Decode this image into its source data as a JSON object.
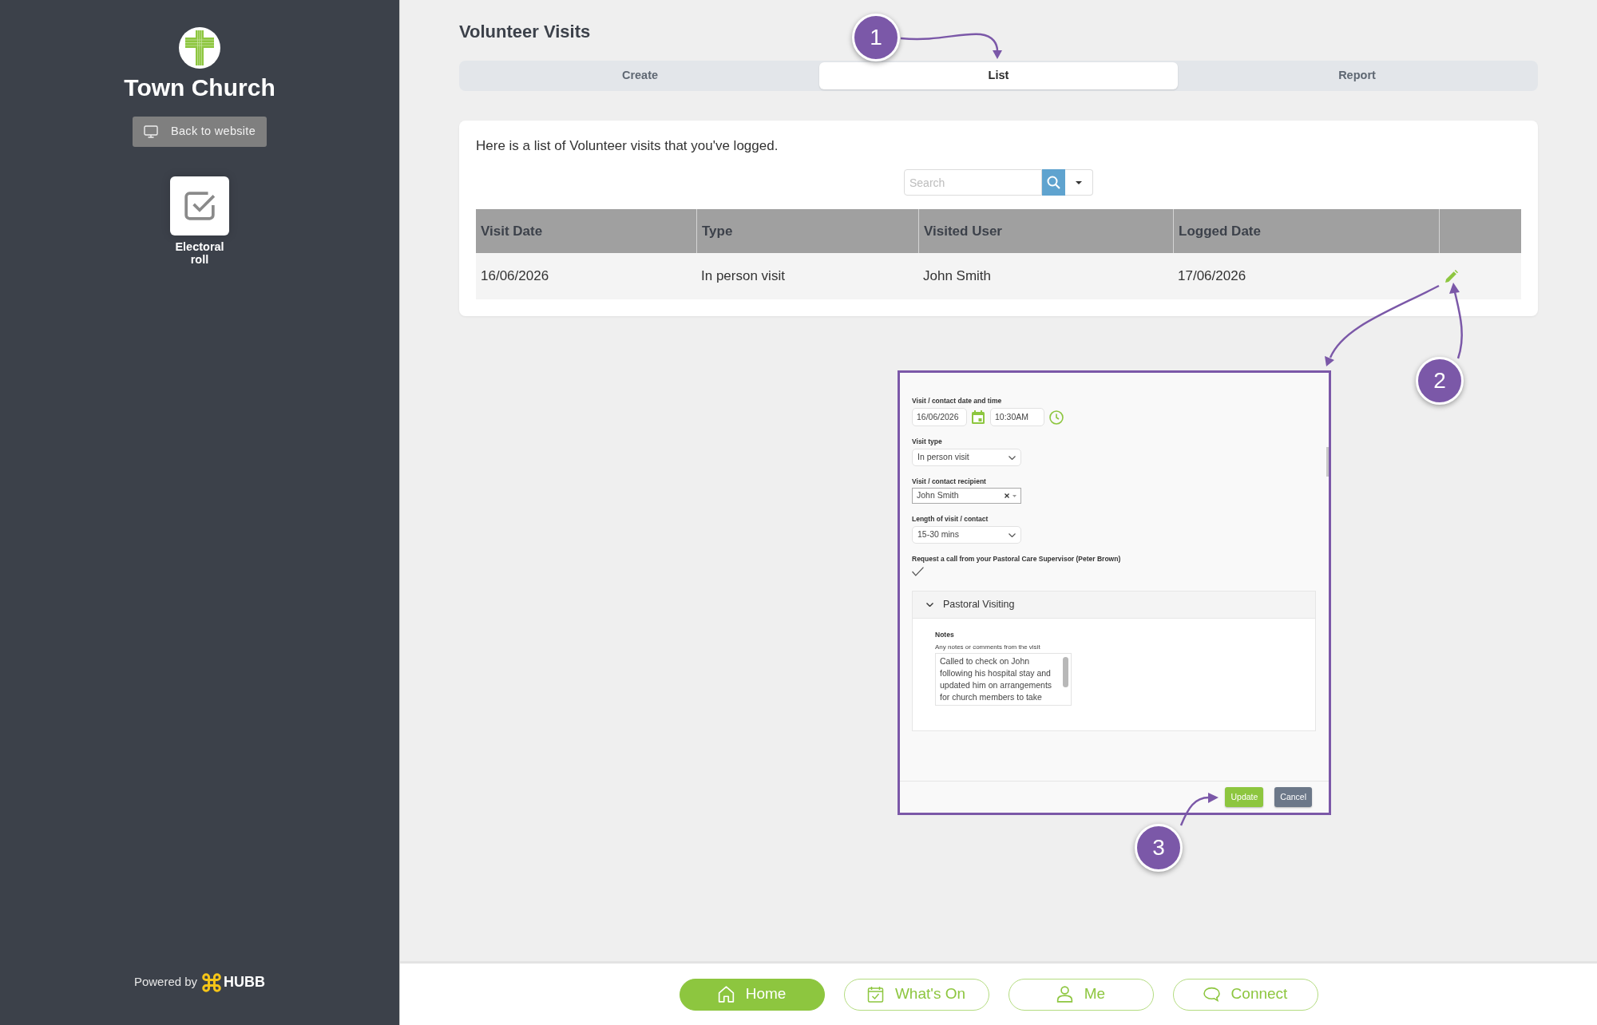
{
  "sidebar": {
    "church_name": "Town Church",
    "back_button": "Back to website",
    "apps": [
      {
        "label": "Electoral roll"
      }
    ],
    "powered_by": "Powered by",
    "brand": "HUBB"
  },
  "page": {
    "title": "Volunteer Visits",
    "tabs": [
      {
        "label": "Create",
        "selected": false
      },
      {
        "label": "List",
        "selected": true
      },
      {
        "label": "Report",
        "selected": false
      }
    ]
  },
  "list_card": {
    "intro": "Here is a list of Volunteer visits that you've logged.",
    "search": {
      "placeholder": "Search"
    },
    "table": {
      "columns": [
        "Visit Date",
        "Type",
        "Visited User",
        "Logged Date"
      ],
      "rows": [
        {
          "cells": [
            "16/06/2026",
            "In person visit",
            "John Smith",
            "17/06/2026"
          ]
        }
      ]
    }
  },
  "edit_form": {
    "fields": [
      {
        "kind": "datetime",
        "label": "Visit / contact date and time",
        "date": "16/06/2026",
        "time": "10:30AM"
      },
      {
        "kind": "select",
        "label": "Visit type",
        "value": "In person visit"
      },
      {
        "kind": "combobox",
        "label": "Visit / contact recipient",
        "value": "John Smith"
      },
      {
        "kind": "select",
        "label": "Length of visit / contact",
        "value": "15-30 mins"
      },
      {
        "kind": "checkbox",
        "label": "Request a call from your Pastoral Care Supervisor (Peter Brown)",
        "checked": true
      }
    ],
    "section": {
      "title": "Pastoral Visiting",
      "expanded": true,
      "notes": {
        "label": "Notes",
        "hint": "Any notes or comments from the visit",
        "value": "Called to check on John following his hospital stay and updated him on arrangements for church members to take"
      }
    },
    "buttons": [
      {
        "label": "Update",
        "kind": "primary"
      },
      {
        "label": "Cancel",
        "kind": "secondary"
      }
    ]
  },
  "annotations": [
    {
      "number": "1"
    },
    {
      "number": "2"
    },
    {
      "number": "3"
    }
  ],
  "bottom_nav": [
    {
      "label": "Home",
      "selected": true
    },
    {
      "label": "What's On",
      "selected": false
    },
    {
      "label": "Me",
      "selected": false
    },
    {
      "label": "Connect",
      "selected": false
    }
  ]
}
